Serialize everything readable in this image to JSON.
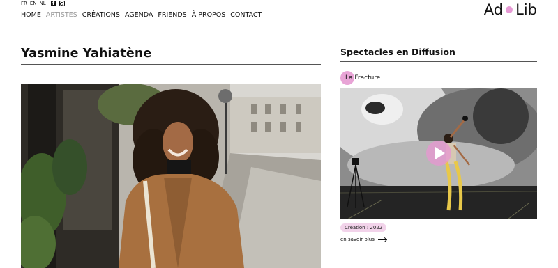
{
  "header": {
    "languages": [
      "FR",
      "EN",
      "NL"
    ],
    "social": {
      "facebook": "facebook-icon",
      "instagram": "instagram-icon"
    },
    "nav": [
      {
        "label": "HOME",
        "active": false
      },
      {
        "label": "ARTISTES",
        "active": true
      },
      {
        "label": "CRÉATIONS",
        "active": false
      },
      {
        "label": "AGENDA",
        "active": false
      },
      {
        "label": "FRIENDS",
        "active": false
      },
      {
        "label": "À PROPOS",
        "active": false
      },
      {
        "label": "CONTACT",
        "active": false
      }
    ],
    "logo": {
      "left": "Ad",
      "right": "Lib"
    }
  },
  "artist": {
    "name": "Yasmine Yahiatène"
  },
  "sidebar": {
    "title": "Spectacles en Diffusion",
    "show": {
      "title": "La Fracture",
      "badge": "Création : 2022",
      "more_label": "en savoir plus"
    }
  },
  "colors": {
    "accent": "#e69ad4",
    "badge_bg": "#f2d3ea",
    "nav_active": "#9b9b9b",
    "text": "#111111"
  }
}
